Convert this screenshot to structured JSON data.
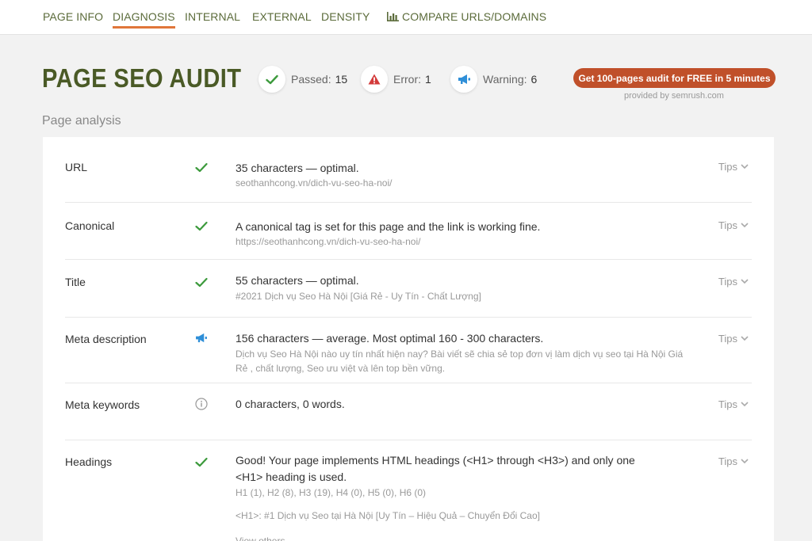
{
  "nav": {
    "items": [
      {
        "label": "PAGE INFO"
      },
      {
        "label": "DIAGNOSIS"
      },
      {
        "label": "INTERNAL"
      },
      {
        "label": "EXTERNAL"
      },
      {
        "label": "DENSITY"
      },
      {
        "label": "COMPARE URLS/DOMAINS",
        "icon": "bar-chart-icon"
      }
    ],
    "active": "DIAGNOSIS"
  },
  "header": {
    "title": "PAGE SEO AUDIT",
    "stats": [
      {
        "label": "Passed:",
        "count": "15",
        "icon": "check-icon",
        "color": "#3c9a3c"
      },
      {
        "label": "Error:",
        "count": "1",
        "icon": "warning-triangle-icon",
        "color": "#d33b3b"
      },
      {
        "label": "Warning:",
        "count": "6",
        "icon": "megaphone-icon",
        "color": "#2f8fd8"
      }
    ],
    "cta_label": "Get 100-pages audit for FREE in 5 minutes",
    "provided_by": "provided by  semrush.com"
  },
  "section_title": "Page analysis",
  "rows": [
    {
      "label": "URL",
      "status": "passed",
      "main": "35 characters — optimal.",
      "sub": "seothanhcong.vn/dich-vu-seo-ha-noi/",
      "tips": "Tips"
    },
    {
      "label": "Canonical",
      "status": "passed",
      "main": "A canonical tag is set for this page and the link is working fine.",
      "sub": "https://seothanhcong.vn/dich-vu-seo-ha-noi/",
      "tips": "Tips"
    },
    {
      "label": "Title",
      "status": "passed",
      "main": "55 characters — optimal.",
      "sub": "#2021 Dịch vụ Seo Hà Nội [Giá Rẻ - Uy Tín - Chất Lượng]",
      "tips": "Tips"
    },
    {
      "label": "Meta description",
      "status": "warning",
      "main": "156 characters — average. Most optimal 160 - 300 characters.",
      "sub": "Dịch vụ Seo Hà Nội nào uy tín nhất hiện nay? Bài viết sẽ chia sẻ top đơn vị làm dịch vụ seo tại Hà Nội Giá Rẻ , chất lượng, Seo ưu việt và lên top bền vững.",
      "tips": "Tips"
    },
    {
      "label": "Meta keywords",
      "status": "info",
      "main": "0 characters, 0 words.",
      "sub": "",
      "tips": "Tips"
    },
    {
      "label": "Headings",
      "status": "passed",
      "main": "Good! Your page implements HTML headings (<H1> through <H3>) and only one <H1> heading is used.",
      "sub": "H1 (1), H2 (8), H3 (19), H4 (0), H5 (0), H6 (0)",
      "sub2": "<H1>: #1 Dịch vụ Seo tại Hà Nội [Uy Tín – Hiệu Quả – Chuyển Đổi Cao]",
      "more": "View others",
      "tips": "Tips"
    }
  ]
}
